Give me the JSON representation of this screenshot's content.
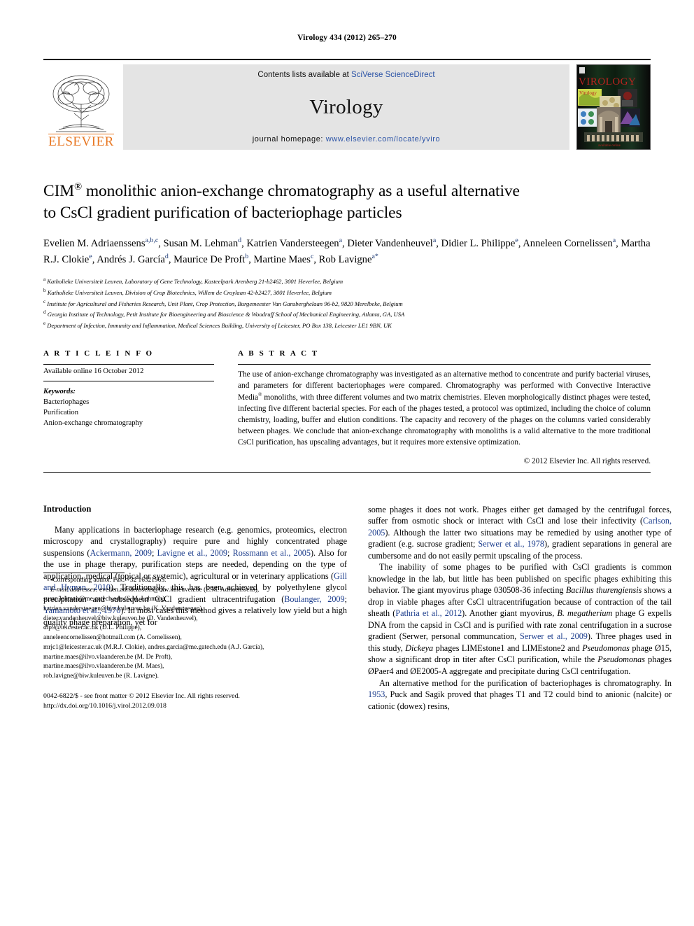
{
  "running_head": "Virology 434 (2012) 265–270",
  "masthead": {
    "publisher_name": "ELSEVIER",
    "contents_prefix": "Contents lists available at ",
    "contents_brand": "SciVerse ScienceDirect",
    "journal_title": "Virology",
    "homepage_prefix": "journal homepage: ",
    "homepage_url": "www.elsevier.com/locate/yviro",
    "cover_title": "VIROLOGY",
    "brand_color": "#e87722",
    "link_color": "#2b53a6"
  },
  "article": {
    "title_line_1": "CIM",
    "title_reg": "®",
    "title_line_1_rest": " monolithic anion-exchange chromatography as a useful alternative",
    "title_line_2": "to CsCl gradient purification of bacteriophage particles",
    "authors": [
      {
        "name": "Evelien M. Adriaenssens",
        "sup": "a,b,c",
        "sep": ", "
      },
      {
        "name": "Susan M. Lehman",
        "sup": "d",
        "sep": ", "
      },
      {
        "name": "Katrien Vandersteegen",
        "sup": "a",
        "sep": ", "
      },
      {
        "name": "Dieter Vandenheuvel",
        "sup": "a",
        "sep": ", "
      },
      {
        "name": "Didier L. Philippe",
        "sup": "e",
        "sep": ", "
      },
      {
        "name": "Anneleen Cornelissen",
        "sup": "a",
        "sep": ", "
      },
      {
        "name": "Martha R.J. Clokie",
        "sup": "e",
        "sep": ", "
      },
      {
        "name": "Andrés J. García",
        "sup": "d",
        "sep": ", "
      },
      {
        "name": "Maurice De Proft",
        "sup": "b",
        "sep": ", "
      },
      {
        "name": "Martine Maes",
        "sup": "c",
        "sep": ", "
      },
      {
        "name": "Rob Lavigne",
        "sup": "a",
        "sep": "",
        "star": "*"
      }
    ],
    "affiliations": [
      {
        "label": "a",
        "text": "Katholieke Universiteit Leuven, Laboratory of Gene Technology, Kasteelpark Arenberg 21-b2462, 3001 Heverlee, Belgium"
      },
      {
        "label": "b",
        "text": "Katholieke Universiteit Leuven, Division of Crop Biotechnics, Willem de Croylaan 42-b2427, 3001 Heverlee, Belgium"
      },
      {
        "label": "c",
        "text": "Institute for Agricultural and Fisheries Research, Unit Plant, Crop Protection, Burgemeester Van Gansberghelaan 96-b2, 9820 Merelbeke, Belgium"
      },
      {
        "label": "d",
        "text": "Georgia Institute of Technology, Petit Institute for Bioengineering and Bioscience & Woodruff School of Mechanical Engineering, Atlanta, GA, USA"
      },
      {
        "label": "e",
        "text": "Department of Infection, Immunity and Inflammation, Medical Sciences Building, University of Leicester, PO Box 138, Leicester LE1 9BN, UK"
      }
    ]
  },
  "article_info": {
    "heading": "A R T I C L E   I N F O",
    "available_online": "Available online 16 October 2012",
    "keywords_heading": "Keywords:",
    "keywords": [
      "Bacteriophages",
      "Purification",
      "Anion-exchange chromatography"
    ]
  },
  "abstract": {
    "heading": "A B S T R A C T",
    "text": "The use of anion-exchange chromatography was investigated as an alternative method to concentrate and purify bacterial viruses, and parameters for different bacteriophages were compared. Chromatography was performed with Convective Interactive Media® monoliths, with three different volumes and two matrix chemistries. Eleven morphologically distinct phages were tested, infecting five different bacterial species. For each of the phages tested, a protocol was optimized, including the choice of column chemistry, loading, buffer and elution conditions. The capacity and recovery of the phages on the columns varied considerably between phages. We conclude that anion-exchange chromatography with monoliths is a valid alternative to the more traditional CsCl purification, has upscaling advantages, but it requires more extensive optimization.",
    "copyright": "© 2012 Elsevier Inc. All rights reserved."
  },
  "introduction": {
    "heading": "Introduction",
    "left_paragraphs": [
      "Many applications in bacteriophage research (e.g. genomics, proteomics, electron microscopy and crystallography) require pure and highly concentrated phage suspensions (Ackermann, 2009; Lavigne et al., 2009; Rossmann et al., 2005). Also for the use in phage therapy, purification steps are needed, depending on the type of application, medical (topical or systemic), agricultural or in veterinary applications (Gill and Hyman, 2010). Traditionally, this has been achieved by polyethylene glycol precipitation and subsequent CsCl gradient ultracentrifugation (Boulanger, 2009; Yamamoto et al., 1970). In most cases this method gives a relatively low yield but a high quality phage preparation, yet for"
    ],
    "right_paragraphs": [
      "some phages it does not work. Phages either get damaged by the centrifugal forces, suffer from osmotic shock or interact with CsCl and lose their infectivity (Carlson, 2005). Although the latter two situations may be remedied by using another type of gradient (e.g. sucrose gradient; Serwer et al., 1978), gradient separations in general are cumbersome and do not easily permit upscaling of the process.",
      "The inability of some phages to be purified with CsCl gradients is common knowledge in the lab, but little has been published on specific phages exhibiting this behavior. The giant myovirus phage 030508-36 infecting Bacillus thurengiensis shows a drop in viable phages after CsCl ultracentrifugation because of contraction of the tail sheath (Pathria et al., 2012). Another giant myovirus, B. megatherium phage G expells DNA from the capsid in CsCl and is purified with rate zonal centrifugation in a sucrose gradient (Serwer, personal communcation, Serwer et al., 2009). Three phages used in this study, Dickeya phages LIMEstone1 and LIMEstone2 and Pseudomonas phage Ø15, show a significant drop in titer after CsCl purification, while the Pseudomonas phages ØPaer4 and ØE2005-A aggregate and precipitate during CsCl centrifugation.",
      "An alternative method for the purification of bacteriophages is chromatography. In 1953, Puck and Sagik proved that phages T1 and T2 could bind to anionic (nalcite) or cationic (dowex) resins,"
    ]
  },
  "footnotes": {
    "corresponding": "Corresponding author. Fax: +32 16321965.",
    "email_label": "E-mail addresses:",
    "emails": [
      "evelien.adriaenssens@biw.kuleuven.be (E.M. Adriaenssens),",
      "susan.lehman@me.gatech.edu (S.M. Lehman),",
      "katrien.vandersteegen@biw.kuleuven.be (K. Vandersteegen),",
      "dieter.vandenheuvel@biw.kuleuven.be (D. Vandenheuvel),",
      "dlp9@leicester.ac.uk (D.L. Philippe),",
      "anneleencornelissen@hotmail.com (A. Cornelissen),",
      "mrjc1@leicester.ac.uk (M.R.J. Clokie), andres.garcia@me.gatech.edu (A.J. García),",
      "martine.maes@ilvo.vlaanderen.be (M. De Proft),",
      "martine.maes@ilvo.vlaanderen.be (M. Maes),",
      "rob.lavigne@biw.kuleuven.be (R. Lavigne)."
    ],
    "front_matter": "0042-6822/$ - see front matter © 2012 Elsevier Inc. All rights reserved.",
    "doi": "http://dx.doi.org/10.1016/j.virol.2012.09.018"
  }
}
